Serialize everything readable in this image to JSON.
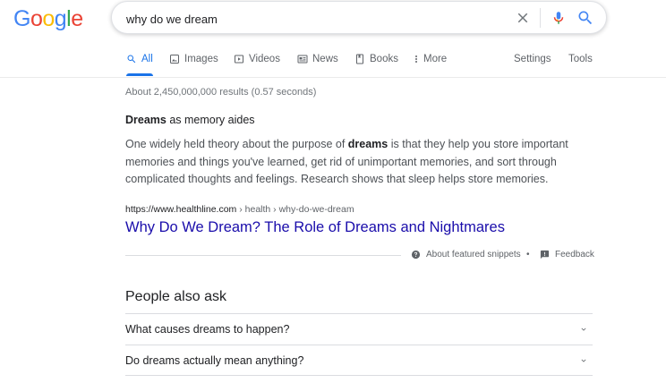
{
  "logo": {
    "letters": [
      "G",
      "o",
      "o",
      "g",
      "l",
      "e"
    ],
    "colors": [
      "#4285F4",
      "#EA4335",
      "#FBBC05",
      "#4285F4",
      "#34A853",
      "#EA4335"
    ]
  },
  "search": {
    "query": "why do we dream"
  },
  "tabs": [
    {
      "label": "All",
      "icon": "search-icon"
    },
    {
      "label": "Images",
      "icon": "image-icon"
    },
    {
      "label": "Videos",
      "icon": "video-icon"
    },
    {
      "label": "News",
      "icon": "news-icon"
    },
    {
      "label": "Books",
      "icon": "book-icon"
    },
    {
      "label": "More",
      "icon": "more-vert-icon"
    }
  ],
  "tools": {
    "settings": "Settings",
    "tools": "Tools"
  },
  "stats": "About 2,450,000,000 results (0.57 seconds)",
  "snippet": {
    "heading_bold": "Dreams",
    "heading_rest": " as memory aides",
    "text_part1": "One widely held theory about the purpose of ",
    "text_bold": "dreams",
    "text_part2": " is that they help you store important memories and things you've learned, get rid of unimportant memories, and sort through complicated thoughts and feelings. Research shows that sleep helps store memories."
  },
  "result": {
    "cite_domain": "https://www.healthline.com",
    "cite_path": " › health › why-do-we-dream",
    "title": "Why Do We Dream? The Role of Dreams and Nightmares"
  },
  "feedback": {
    "about": "About featured snippets",
    "separator": "•",
    "feedback": "Feedback"
  },
  "paa": {
    "title": "People also ask",
    "questions": [
      "What causes dreams to happen?",
      "Do dreams actually mean anything?"
    ]
  },
  "colors": {
    "link": "#1a0dab",
    "accent": "#1a73e8",
    "muted": "#70757a"
  }
}
